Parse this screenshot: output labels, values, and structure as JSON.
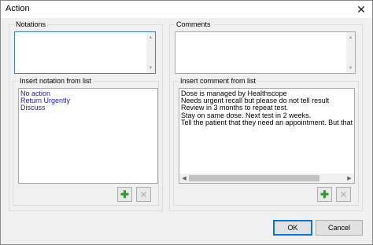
{
  "window": {
    "title": "Action",
    "close_glyph": "✕"
  },
  "notations": {
    "group_label": "Notations",
    "value": "",
    "insert_label": "Insert notation from list",
    "items": [
      "No action",
      "Return Urgently",
      "Discuss"
    ]
  },
  "comments": {
    "group_label": "Comments",
    "value": "",
    "insert_label": "Insert comment from list",
    "items": [
      "Dose is managed by Healthscope",
      "Needs urgent recall but please do not tell result",
      "Review in 3 months to repeat test.",
      "Stay on same dose. Next test in 2 weeks.",
      "Tell the patient that they need an appointment.  But that all is"
    ]
  },
  "icons": {
    "add": "plus-icon",
    "remove": "x-icon",
    "add_glyph": "✚",
    "remove_glyph": "✕"
  },
  "buttons": {
    "ok": "OK",
    "cancel": "Cancel"
  },
  "colors": {
    "list_text": "#1a1aaa",
    "focus_border": "#3c7fb1",
    "add_icon": "#2e9b2e"
  }
}
